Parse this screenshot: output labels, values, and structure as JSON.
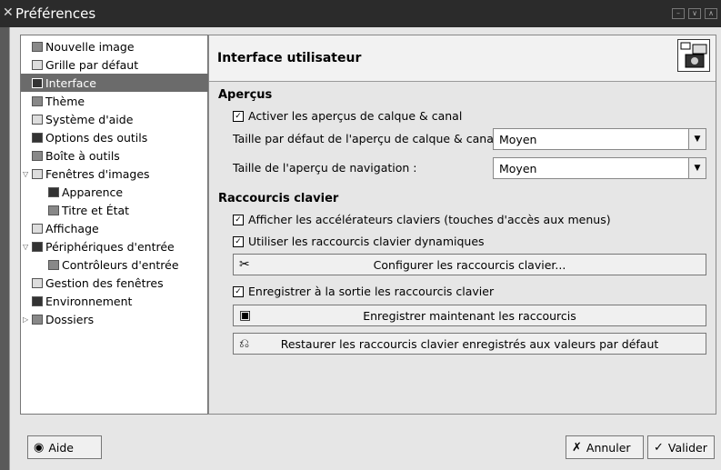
{
  "window": {
    "title": "Préférences"
  },
  "tree": {
    "items": [
      {
        "label": "Nouvelle image",
        "icon": "new-image-icon"
      },
      {
        "label": "Grille par défaut",
        "icon": "grid-icon"
      },
      {
        "label": "Interface",
        "icon": "interface-icon",
        "selected": true
      },
      {
        "label": "Thème",
        "icon": "theme-icon"
      },
      {
        "label": "Système d'aide",
        "icon": "help-system-icon"
      },
      {
        "label": "Options des outils",
        "icon": "tool-options-icon"
      },
      {
        "label": "Boîte à outils",
        "icon": "toolbox-icon"
      },
      {
        "label": "Fenêtres d'images",
        "icon": "image-windows-icon",
        "expander": "▽"
      },
      {
        "label": "Apparence",
        "icon": "appearance-icon",
        "indent": true
      },
      {
        "label": "Titre et État",
        "icon": "title-status-icon",
        "indent": true
      },
      {
        "label": "Affichage",
        "icon": "display-icon"
      },
      {
        "label": "Périphériques d'entrée",
        "icon": "input-devices-icon",
        "expander": "▽"
      },
      {
        "label": "Contrôleurs d'entrée",
        "icon": "input-controllers-icon",
        "indent": true
      },
      {
        "label": "Gestion des fenêtres",
        "icon": "window-management-icon"
      },
      {
        "label": "Environnement",
        "icon": "environment-icon"
      },
      {
        "label": "Dossiers",
        "icon": "folders-icon",
        "expander": "▷"
      }
    ]
  },
  "content": {
    "title": "Interface utilisateur",
    "previews": {
      "section": "Aperçus",
      "activate_label": "Activer les aperçus de calque & canal",
      "activate_checked": true,
      "layer_preview_label": "Taille par défaut de l'aperçu de calque & canal :",
      "layer_preview_value": "Moyen",
      "nav_preview_label": "Taille de l'aperçu de navigation :",
      "nav_preview_value": "Moyen"
    },
    "shortcuts": {
      "section": "Raccourcis clavier",
      "show_accel_label": "Afficher les accélérateurs claviers (touches d'accès aux menus)",
      "show_accel_checked": true,
      "dynamic_label": "Utiliser les raccourcis clavier dynamiques",
      "dynamic_checked": true,
      "configure_button": "Configurer les raccourcis clavier...",
      "save_on_exit_label": "Enregistrer à la sortie les raccourcis clavier",
      "save_on_exit_checked": true,
      "save_now_button": "Enregistrer maintenant les raccourcis",
      "restore_button": "Restaurer les raccourcis clavier enregistrés aux valeurs par défaut"
    }
  },
  "footer": {
    "help_button": "Aide",
    "cancel_button": "Annuler",
    "ok_button": "Valider"
  }
}
